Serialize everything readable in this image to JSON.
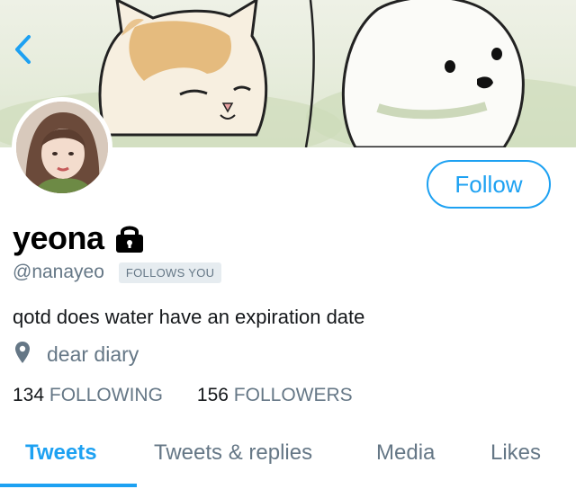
{
  "profile": {
    "display_name": "yeona",
    "handle": "@nanayeo",
    "follows_you_badge": "FOLLOWS YOU",
    "bio": "qotd does water have an expiration date",
    "location": "dear diary",
    "following_count": "134",
    "following_label": "FOLLOWING",
    "followers_count": "156",
    "followers_label": "FOLLOWERS"
  },
  "actions": {
    "follow_label": "Follow"
  },
  "tabs": [
    {
      "label": "Tweets",
      "active": true
    },
    {
      "label": "Tweets & replies",
      "active": false
    },
    {
      "label": "Media",
      "active": false
    },
    {
      "label": "Likes",
      "active": false
    }
  ],
  "colors": {
    "accent": "#1da1f2",
    "secondary_text": "#657786",
    "primary_text": "#14171a"
  },
  "icons": {
    "back": "chevron-left-icon",
    "lock": "lock-icon",
    "location": "map-pin-icon"
  }
}
